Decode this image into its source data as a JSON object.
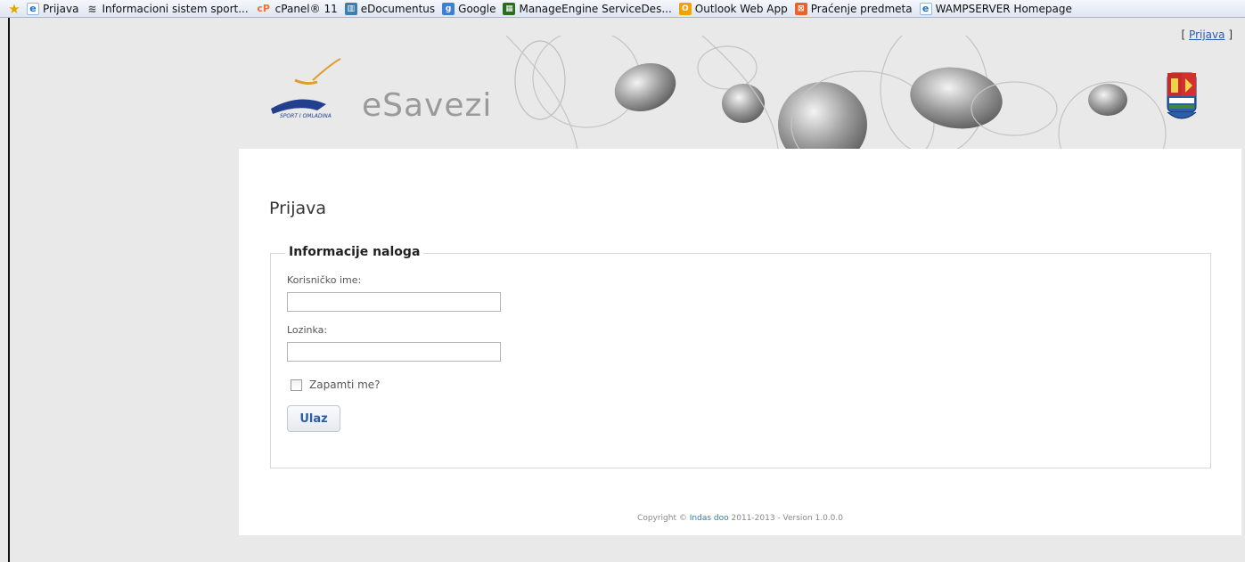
{
  "favorites": [
    {
      "label": "Prijava",
      "icon": "ie-icon"
    },
    {
      "label": "Informacioni sistem sport...",
      "icon": "sport-icon"
    },
    {
      "label": "cPanel® 11",
      "icon": "cpanel-icon"
    },
    {
      "label": "eDocumentus",
      "icon": "edocumentus-icon"
    },
    {
      "label": "Google",
      "icon": "google-icon"
    },
    {
      "label": "ManageEngine ServiceDes...",
      "icon": "manageengine-icon"
    },
    {
      "label": "Outlook Web App",
      "icon": "outlook-icon"
    },
    {
      "label": "Praćenje predmeta",
      "icon": "pracenje-icon"
    },
    {
      "label": "WAMPSERVER Homepage",
      "icon": "ie-icon"
    }
  ],
  "header": {
    "brand": "eSavezi",
    "login_link_prefix": "[",
    "login_link": "Prijava",
    "login_link_suffix": "]"
  },
  "form": {
    "title": "Prijava",
    "legend": "Informacije naloga",
    "username_label": "Korisničko ime:",
    "username_value": "",
    "password_label": "Lozinka:",
    "password_value": "",
    "remember_label": "Zapamti me?",
    "submit_label": "Ulaz"
  },
  "footer": {
    "prefix": "Copyright ©",
    "company": "Indas doo",
    "suffix": "2011-2013 - Version 1.0.0.0"
  }
}
